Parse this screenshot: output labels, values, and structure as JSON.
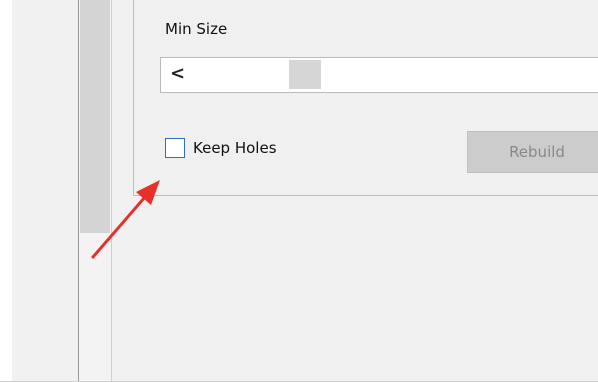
{
  "settings": {
    "min_size_label": "Min Size",
    "scroll_left_glyph": "<",
    "keep_holes_label": "Keep Holes",
    "keep_holes_checked": false,
    "rebuild_label": "Rebuild",
    "rebuild_enabled": false
  },
  "annotation": {
    "type": "red-arrow",
    "color": "#e8302b",
    "points_to": "keep-holes-checkbox"
  },
  "colors": {
    "checkbox_border": "#2e6fb9",
    "button_disabled_bg": "#cccccc",
    "button_disabled_text": "#888888"
  }
}
